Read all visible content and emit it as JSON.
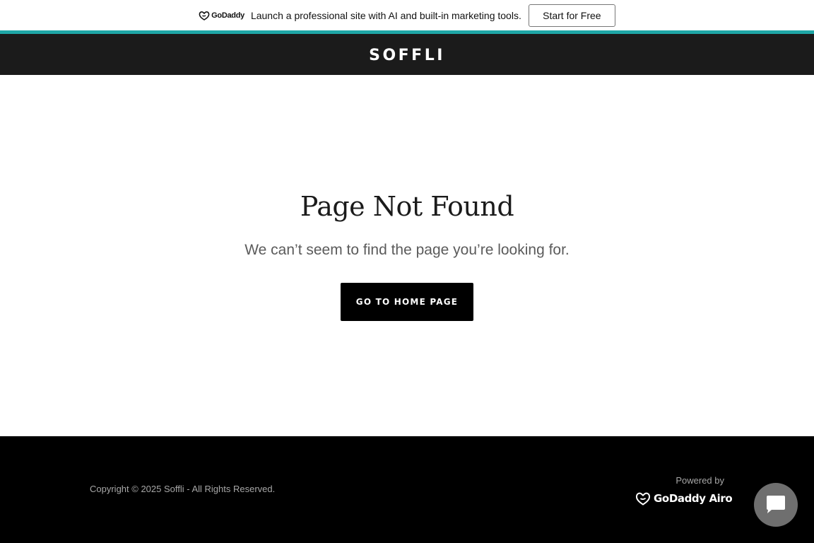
{
  "promo": {
    "logo_text": "GoDaddy",
    "message": "Launch a professional site with AI and built-in marketing tools.",
    "cta_label": "Start for Free"
  },
  "header": {
    "brand": "SOFFLI"
  },
  "main": {
    "title": "Page Not Found",
    "subtitle": "We can’t seem to find the page you’re looking for.",
    "home_button": "GO TO HOME PAGE"
  },
  "footer": {
    "copyright": "Copyright © 2025 Soffli - All Rights Reserved.",
    "powered_by": "Powered by",
    "powered_logo": "GoDaddy Airo"
  },
  "icons": {
    "promo_logo": "godaddy-logo-icon",
    "footer_logo": "godaddy-airo-logo-icon",
    "chat": "chat-bubble-icon"
  },
  "colors": {
    "accent_teal": "#1fa6a6",
    "header_bg": "#1b1b1b",
    "footer_bg": "#000000",
    "button_bg": "#000000",
    "chat_button_bg": "#6f6f6f"
  }
}
